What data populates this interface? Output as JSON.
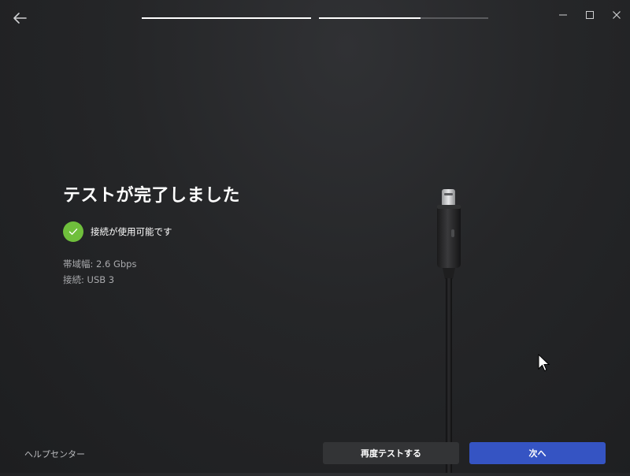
{
  "window": {
    "back_icon": "arrow-left-icon",
    "minimize_icon": "minimize-icon",
    "maximize_icon": "maximize-icon",
    "close_icon": "close-icon"
  },
  "progress": {
    "steps": [
      {
        "fill": 1.0
      },
      {
        "fill": 0.6
      }
    ],
    "color_active": "#ffffff",
    "color_inactive": "#5a5b5e"
  },
  "main": {
    "title": "テストが完了しました",
    "status": {
      "icon": "checkmark-circle-icon",
      "color": "#6fbf3c",
      "text": "接続が使用可能です"
    },
    "details": [
      {
        "text": "帯域幅: 2.6 Gbps"
      },
      {
        "text": "接続: USB 3"
      }
    ]
  },
  "illustration": {
    "icon": "usb-c-cable-icon"
  },
  "footer": {
    "help_link": "ヘルプセンター",
    "retest_button": "再度テストする",
    "next_button": "次へ",
    "accent_color": "#3554c3"
  }
}
